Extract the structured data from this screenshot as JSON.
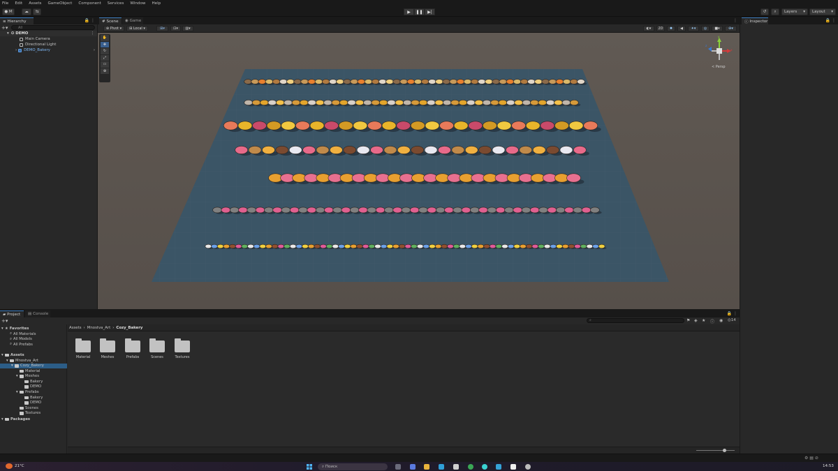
{
  "menu": [
    "File",
    "Edit",
    "Assets",
    "GameObject",
    "Component",
    "Services",
    "Window",
    "Help"
  ],
  "toolbar": {
    "account": "M",
    "layers": "Layers",
    "layout": "Layout"
  },
  "hierarchy": {
    "tab": "Hierarchy",
    "search_placeholder": "All",
    "items": [
      {
        "label": "DEMO",
        "depth": 0
      },
      {
        "label": "Main Camera",
        "depth": 1
      },
      {
        "label": "Directional Light",
        "depth": 1
      },
      {
        "label": "DEMO_Bakery",
        "depth": 1
      }
    ]
  },
  "scene": {
    "tab_scene": "Scene",
    "tab_game": "Game",
    "pivot": "Pivot",
    "space": "Local",
    "gizmo_label": "< Persp",
    "gizmo_x": "x",
    "gizmo_y": "y",
    "gizmo_z": "z"
  },
  "inspector": {
    "tab": "Inspector"
  },
  "project": {
    "tab_project": "Project",
    "tab_console": "Console",
    "count": "14",
    "breadcrumb": [
      "Assets",
      "Mnostva_Art",
      "Cozy_Bakery"
    ],
    "tree": [
      {
        "label": "Favorites",
        "depth": 0,
        "bold": true
      },
      {
        "label": "All Materials",
        "depth": 1
      },
      {
        "label": "All Models",
        "depth": 1
      },
      {
        "label": "All Prefabs",
        "depth": 1
      },
      {
        "label": "Assets",
        "depth": 0,
        "bold": true
      },
      {
        "label": "Mnostva_Art",
        "depth": 1
      },
      {
        "label": "Cozy_Bakery",
        "depth": 2,
        "selected": true
      },
      {
        "label": "Material",
        "depth": 3
      },
      {
        "label": "Meshes",
        "depth": 3
      },
      {
        "label": "Bakery",
        "depth": 4
      },
      {
        "label": "DEMO",
        "depth": 4
      },
      {
        "label": "Prefabs",
        "depth": 3
      },
      {
        "label": "Bakery",
        "depth": 4
      },
      {
        "label": "DEMO",
        "depth": 4
      },
      {
        "label": "Scenes",
        "depth": 3
      },
      {
        "label": "Textures",
        "depth": 3
      },
      {
        "label": "Packages",
        "depth": 0,
        "bold": true
      }
    ],
    "folders": [
      "Material",
      "Meshes",
      "Prefabs",
      "Scenes",
      "Textures"
    ]
  },
  "taskbar": {
    "weather": "21°C",
    "search": "Поиск",
    "time": "14:53"
  },
  "colors": {
    "accent": "#3a79bb",
    "ground": "#3b5566",
    "selection": "#2c5d87"
  }
}
